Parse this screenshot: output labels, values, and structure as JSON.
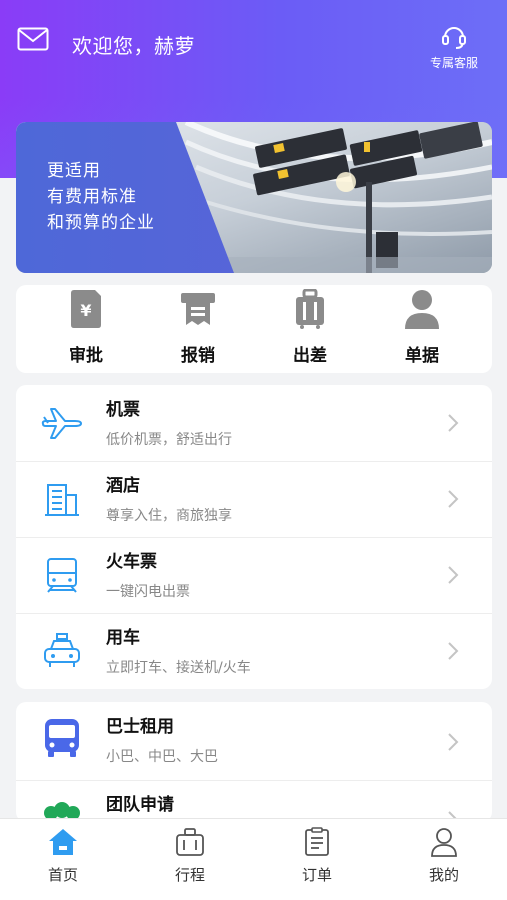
{
  "header": {
    "welcome": "欢迎您，赫萝",
    "service_label": "专属客服"
  },
  "banner": {
    "lines": [
      "更适用",
      "有费用标准",
      "和预算的企业"
    ]
  },
  "quick_actions": [
    {
      "label": "审批",
      "icon": "approval-icon"
    },
    {
      "label": "报销",
      "icon": "reimburse-icon"
    },
    {
      "label": "出差",
      "icon": "luggage-icon"
    },
    {
      "label": "单据",
      "icon": "person-icon"
    }
  ],
  "services": [
    {
      "title": "机票",
      "subtitle": "低价机票，舒适出行",
      "icon": "airplane-icon"
    },
    {
      "title": "酒店",
      "subtitle": "尊享入住，商旅独享",
      "icon": "hotel-icon"
    },
    {
      "title": "火车票",
      "subtitle": "一键闪电出票",
      "icon": "train-icon"
    },
    {
      "title": "用车",
      "subtitle": "立即打车、接送机/火车",
      "icon": "taxi-icon"
    }
  ],
  "services2": [
    {
      "title": "巴士租用",
      "subtitle": "小巴、中巴、大巴",
      "icon": "bus-icon"
    },
    {
      "title": "团队申请",
      "subtitle": "",
      "icon": "team-icon"
    }
  ],
  "tabs": [
    {
      "label": "首页",
      "icon": "home-icon",
      "active": true
    },
    {
      "label": "行程",
      "icon": "suitcase-icon",
      "active": false
    },
    {
      "label": "订单",
      "icon": "order-icon",
      "active": false
    },
    {
      "label": "我的",
      "icon": "user-icon",
      "active": false
    }
  ],
  "colors": {
    "header_gradient_start": "#8a3cf7",
    "header_gradient_end": "#6d6ef7",
    "accent_blue": "#2f9cf0",
    "bus_blue": "#4a68e8",
    "icon_gray": "#8b8b8b"
  }
}
